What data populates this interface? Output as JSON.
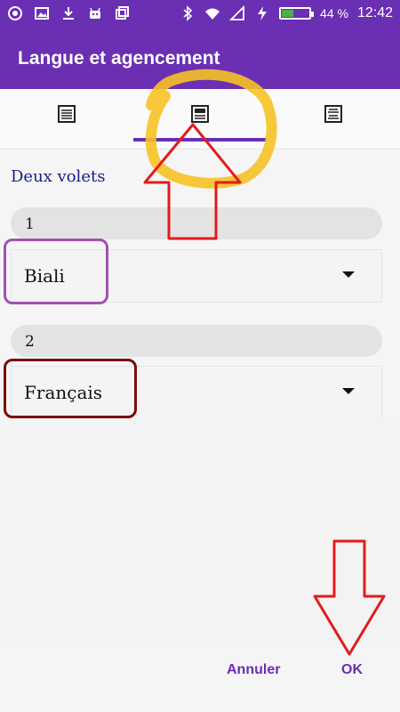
{
  "status_bar": {
    "battery": "44 %",
    "battery_level": 0.44,
    "time": "12:42",
    "icons": [
      "app-icon",
      "image-icon",
      "download-icon",
      "android-icon",
      "layers-icon",
      "bluetooth-icon",
      "wifi-icon",
      "signal-icon",
      "charging-icon",
      "battery-icon"
    ]
  },
  "app_bar": {
    "title": "Langue et agencement"
  },
  "tabs": [
    {
      "icon": "single-pane-icon",
      "selected": false
    },
    {
      "icon": "two-pane-icon",
      "selected": true
    },
    {
      "icon": "interlinear-icon",
      "selected": false
    }
  ],
  "section": {
    "title": "Deux volets"
  },
  "panes": [
    {
      "number": "1",
      "language": "Biali"
    },
    {
      "number": "2",
      "language": "Français"
    }
  ],
  "buttons": {
    "cancel": "Annuler",
    "ok": "OK"
  },
  "colors": {
    "accent": "#6a2fb3",
    "annotation_yellow": "#f6c223",
    "annotation_red": "#e31b1b",
    "annotation_purple": "#a34fb5",
    "annotation_darkred": "#7d0a0a"
  }
}
